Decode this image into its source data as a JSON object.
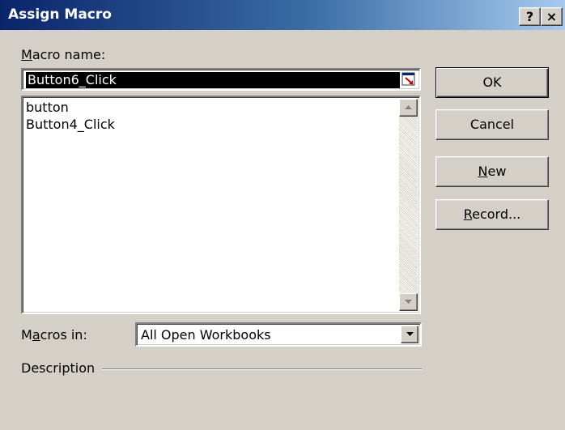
{
  "window": {
    "title": "Assign Macro",
    "help_label": "?",
    "close_label": "×"
  },
  "macro_name": {
    "label_key": "M",
    "label_rest": "acro name:",
    "value": "Button6_Click"
  },
  "macro_list": {
    "items": [
      "button",
      "Button4_Click"
    ]
  },
  "macros_in": {
    "label_pre": "M",
    "label_key": "a",
    "label_rest": "cros in:",
    "value": "All Open Workbooks"
  },
  "description": {
    "label": "Description"
  },
  "buttons": {
    "ok": "OK",
    "cancel": "Cancel",
    "new_key": "N",
    "new_rest": "ew",
    "record_key": "R",
    "record_rest": "ecord..."
  },
  "icons": {
    "refedit": "collapse-dialog-icon",
    "scroll_up": "scroll-up-arrow-icon",
    "scroll_down": "scroll-down-arrow-icon",
    "dropdown": "dropdown-arrow-icon"
  },
  "colors": {
    "title_start": "#0a246a",
    "title_end": "#a6caf0",
    "face": "#d4d0c8",
    "selection": "#000000"
  }
}
